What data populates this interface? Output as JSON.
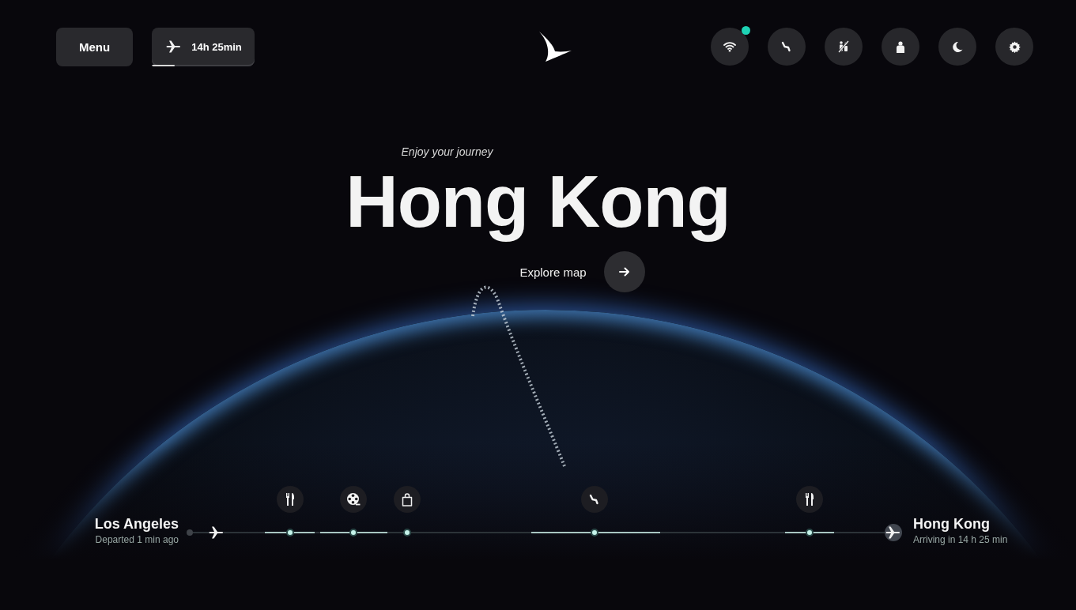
{
  "header": {
    "menu_button": "Menu",
    "flight_time": {
      "label": "14h 25min",
      "level": 0.22
    },
    "actions": [
      {
        "kind": "wifi",
        "badge": true
      },
      {
        "kind": "seat",
        "badge": false
      },
      {
        "kind": "no-kids",
        "badge": false
      },
      {
        "kind": "person",
        "badge": false
      },
      {
        "kind": "moon",
        "badge": false
      },
      {
        "kind": "gear",
        "badge": false
      }
    ]
  },
  "hero": {
    "subtitle": "Enjoy your journey",
    "title": "Hong Kong",
    "link": "Explore map"
  },
  "timeline": {
    "origin": {
      "city": "Los Angeles",
      "status": "Departed 1 min ago"
    },
    "destination": {
      "city": "Hong Kong",
      "status": "Arriving in 14 h 25 min"
    },
    "events": [
      {
        "kind": "meal"
      },
      {
        "kind": "movie"
      },
      {
        "kind": "shopping"
      },
      {
        "kind": "seat"
      },
      {
        "kind": "meal"
      }
    ]
  }
}
